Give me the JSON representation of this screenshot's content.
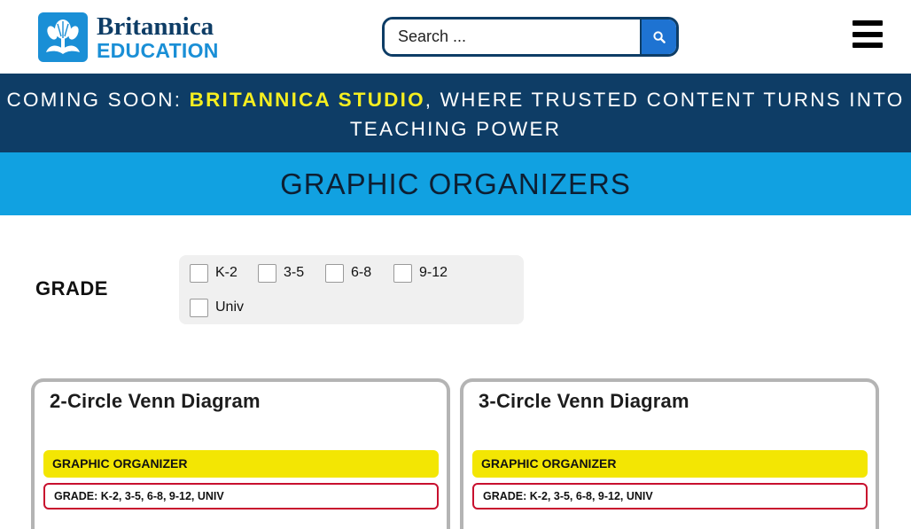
{
  "header": {
    "logo": {
      "top": "Britannica",
      "bottom": "EDUCATION"
    },
    "search": {
      "placeholder": "Search ..."
    },
    "menu_icon": "hamburger-icon"
  },
  "announcement": {
    "prefix": "COMING SOON: ",
    "highlight": "BRITANNICA STUDIO",
    "suffix": ", WHERE TRUSTED CONTENT TURNS INTO TEACHING POWER"
  },
  "page_title": "GRAPHIC ORGANIZERS",
  "filters": {
    "grade_label": "GRADE",
    "options": [
      "K-2",
      "3-5",
      "6-8",
      "9-12",
      "Univ"
    ]
  },
  "cards": [
    {
      "title": "2-Circle Venn Diagram",
      "type": "GRAPHIC ORGANIZER",
      "grade": "GRADE: K-2, 3-5, 6-8, 9-12, UNIV"
    },
    {
      "title": "3-Circle Venn Diagram",
      "type": "GRAPHIC ORGANIZER",
      "grade": "GRADE: K-2, 3-5, 6-8, 9-12, UNIV"
    }
  ],
  "colors": {
    "navy": "#0e3d66",
    "brand_blue": "#1a8fd6",
    "title_band": "#11a1e1",
    "highlight_yellow": "#f5ee20",
    "tag_yellow": "#f3e603",
    "tag_red_border": "#c8102e"
  }
}
